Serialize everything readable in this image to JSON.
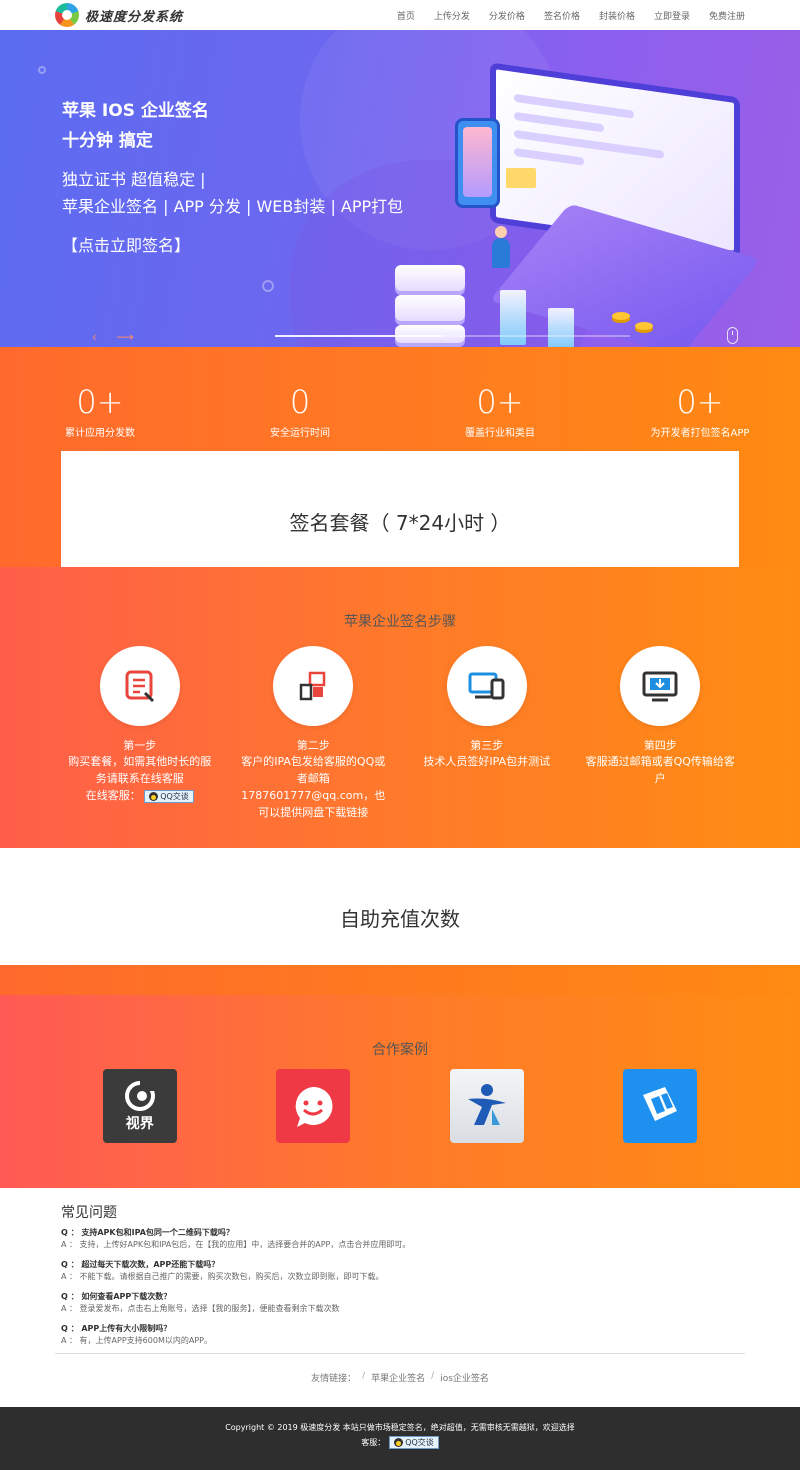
{
  "header": {
    "brand": "极速度分发系统",
    "nav": [
      "首页",
      "上传分发",
      "分发价格",
      "签名价格",
      "封装价格",
      "立即登录",
      "免费注册"
    ]
  },
  "hero": {
    "line1": "苹果 IOS 企业签名",
    "line2": "十分钟 搞定",
    "line3": "独立证书 超值稳定 |",
    "line4": "苹果企业签名 | APP 分发 | WEB封装 | APP打包",
    "cta": "【点击立即签名】",
    "arrows": "‹ ⟶"
  },
  "stats": [
    {
      "num": "0+",
      "label": "累计应用分发数"
    },
    {
      "num": "0",
      "label": "安全运行时间"
    },
    {
      "num": "0+",
      "label": "覆盖行业和类目"
    },
    {
      "num": "0+",
      "label": "为开发者打包签名APP"
    }
  ],
  "package": {
    "title": "签名套餐（ 7*24小时 ）"
  },
  "steps": {
    "title": "苹果企业签名步骤",
    "items": [
      {
        "name": "第一步",
        "desc": "购买套餐，如需其他时长的服务请联系在线客服",
        "extra": "在线客服：",
        "qq": "QQ交谈",
        "icon": "document-edit-icon"
      },
      {
        "name": "第二步",
        "desc": "客户的IPA包发给客服的QQ或者邮箱1787601777@qq.com，也可以提供网盘下载链接",
        "icon": "grid-blocks-icon"
      },
      {
        "name": "第三步",
        "desc": "技术人员签好IPA包并测试",
        "icon": "devices-icon"
      },
      {
        "name": "第四步",
        "desc": "客服通过邮箱或者QQ传输给客户",
        "icon": "monitor-download-icon"
      }
    ]
  },
  "recharge": {
    "title": "自助充值次数"
  },
  "cases": {
    "title": "合作案例",
    "items": [
      {
        "label": "视界",
        "icon": "eye-app-icon",
        "color": "#3b3b3b"
      },
      {
        "label": "",
        "icon": "smile-chat-icon",
        "color": "#ef3a45"
      },
      {
        "label": "",
        "icon": "runner-app-icon",
        "color": "#e6e9ee"
      },
      {
        "label": "",
        "icon": "book-app-icon",
        "color": "#1e90ef"
      }
    ]
  },
  "faq": {
    "title": "常见问题",
    "items": [
      {
        "q": "Q ：  支持APK包和IPA包同一个二维码下载吗？",
        "a": "A ：  支持，上传好APK包和IPA包后，在【我的应用】中，选择要合并的APP，点击合并应用即可。"
      },
      {
        "q": "Q ：  超过每天下载次数，APP还能下载吗？",
        "a": "A ：  不能下载。请根据自己推广的需要，购买次数包，购买后，次数立即到账，即可下载。"
      },
      {
        "q": "Q ：  如何查看APP下载次数？",
        "a": "A ：  登录爱发布，点击右上角账号，选择【我的服务】，便能查看剩余下载次数"
      },
      {
        "q": "Q ：  APP上传有大小限制吗？",
        "a": "A ：  有，上传APP支持600M以内的APP。"
      }
    ]
  },
  "links": {
    "label": "友情链接：",
    "items": [
      "苹果企业签名",
      "ios企业签名"
    ],
    "sep": "/"
  },
  "footer": {
    "copyright": "Copyright © 2019 极速度分发      本站只做市场稳定签名，绝对超值，无需审核无需越狱，欢迎选择",
    "service": "客服：",
    "qq": "QQ交谈"
  }
}
